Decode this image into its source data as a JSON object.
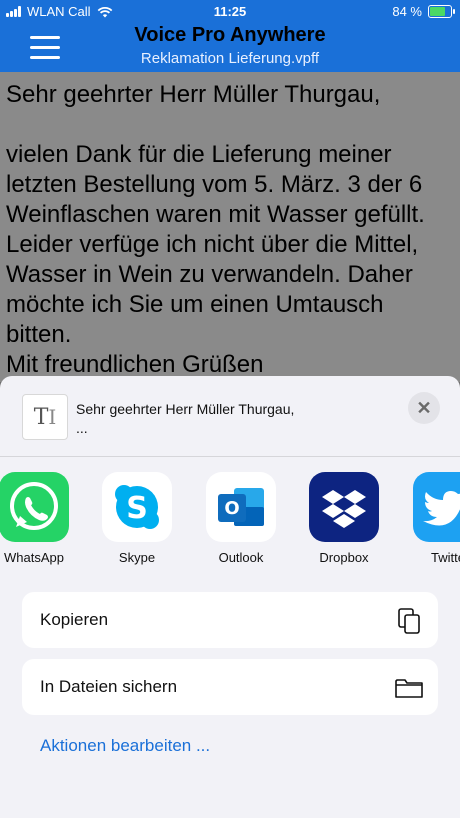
{
  "status_bar": {
    "carrier": "WLAN Call",
    "time": "11:25",
    "battery": "84 %",
    "battery_level": 0.84
  },
  "nav": {
    "title": "Voice Pro Anywhere",
    "subtitle": "Reklamation Lieferung.vpff"
  },
  "document": {
    "greeting": "Sehr geehrter Herr Müller Thurgau,",
    "body": "vielen Dank für die Lieferung meiner letzten Bestellung vom 5. März. 3 der 6 Weinflaschen waren mit Wasser gefüllt. Leider verfüge ich nicht über die Mittel, Wasser in Wein zu verwandeln. Daher möchte ich Sie um einen Umtausch bitten.",
    "closing": "Mit freundlichen Grüßen"
  },
  "share_sheet": {
    "preview_line1": "Sehr geehrter Herr Müller Thurgau,",
    "preview_line2": "...",
    "apps": [
      {
        "label": "WhatsApp",
        "color": "#25d366"
      },
      {
        "label": "Skype",
        "color": "#00aff0"
      },
      {
        "label": "Outlook",
        "color": "#0f6cbd"
      },
      {
        "label": "Dropbox",
        "color": "#0d2481"
      },
      {
        "label": "Twitte",
        "color": "#1da1f2"
      }
    ],
    "actions": [
      {
        "label": "Kopieren",
        "icon": "copy-icon"
      },
      {
        "label": "In Dateien sichern",
        "icon": "folder-icon"
      }
    ],
    "edit_actions": "Aktionen bearbeiten ..."
  },
  "colors": {
    "accent": "#1a70d8",
    "sheet_bg": "#f2f2f7"
  }
}
